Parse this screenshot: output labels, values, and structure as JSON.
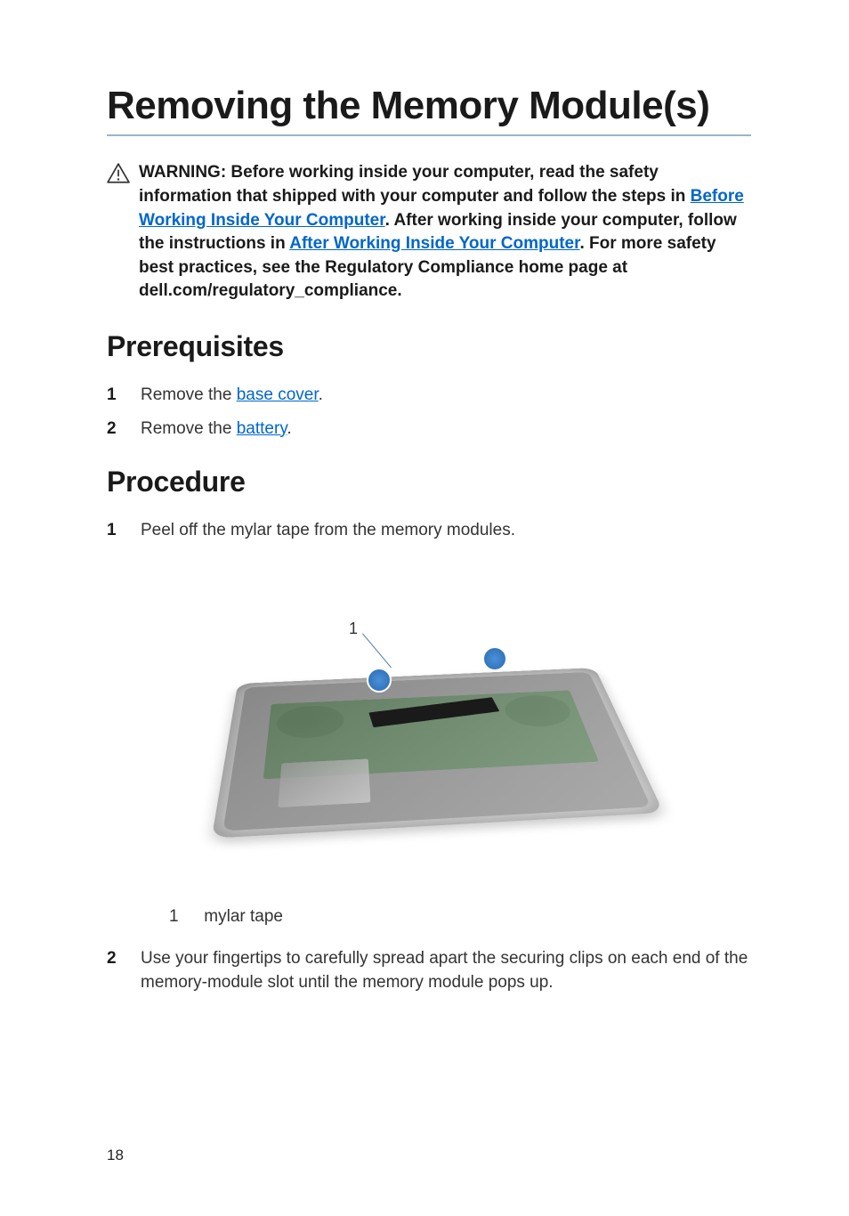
{
  "title": "Removing the Memory Module(s)",
  "warning": {
    "part1": "WARNING: Before working inside your computer, read the safety information that shipped with your computer and follow the steps in ",
    "link1": "Before Working Inside Your Computer",
    "part2": ". After working inside your computer, follow the instructions in ",
    "link2": "After Working Inside Your Computer",
    "part3": ". For more safety best practices, see the Regulatory Compliance home page at dell.com/regulatory_compliance."
  },
  "sections": {
    "prerequisites": {
      "heading": "Prerequisites",
      "items": [
        {
          "num": "1",
          "pre": "Remove the ",
          "link": "base cover",
          "post": "."
        },
        {
          "num": "2",
          "pre": "Remove the ",
          "link": "battery",
          "post": "."
        }
      ]
    },
    "procedure": {
      "heading": "Procedure",
      "items": [
        {
          "num": "1",
          "text": "Peel off the mylar tape from the memory modules."
        },
        {
          "num": "2",
          "text": "Use your fingertips to carefully spread apart the securing clips on each end of the memory-module slot until the memory module pops up."
        }
      ]
    }
  },
  "figure": {
    "callout_num": "1",
    "legend_num": "1",
    "legend_text": "mylar tape"
  },
  "page_number": "18"
}
